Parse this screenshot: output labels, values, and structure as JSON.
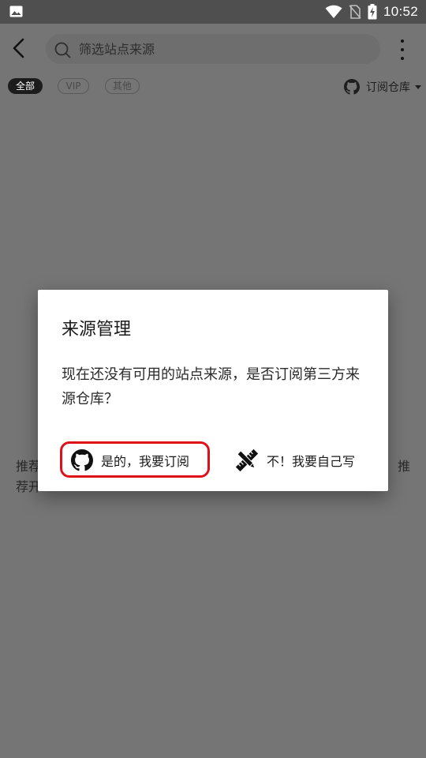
{
  "status_bar": {
    "time": "10:52",
    "icons": [
      "gallery-icon",
      "wifi-icon",
      "no-sim-icon",
      "battery-charging-icon"
    ]
  },
  "toolbar": {
    "back_icon": "back-arrow-icon",
    "search": {
      "placeholder": "筛选站点来源",
      "value": ""
    },
    "more_icon": "more-vert-icon"
  },
  "filters": {
    "chips": [
      {
        "label": "全部",
        "selected": true
      },
      {
        "label": "VIP",
        "selected": false
      },
      {
        "label": "其他",
        "selected": false
      }
    ],
    "subscribe": {
      "label": "订阅仓库",
      "icon": "github-icon"
    }
  },
  "background": {
    "hint_visible_left": "推荐",
    "hint_visible_right": "推",
    "hint_line2": "荐开"
  },
  "dialog": {
    "title": "来源管理",
    "message": "现在还没有可用的站点来源，是否订阅第三方来源仓库？",
    "yes_label": "是的，我要订阅",
    "no_label": "不！我要自己写"
  },
  "colors": {
    "overlay_bg": "#757575",
    "status_bar": "#4f4f4f",
    "dialog_bg": "#ffffff",
    "highlight": "#e0101b",
    "chip_selected": "#1c1c1c"
  }
}
